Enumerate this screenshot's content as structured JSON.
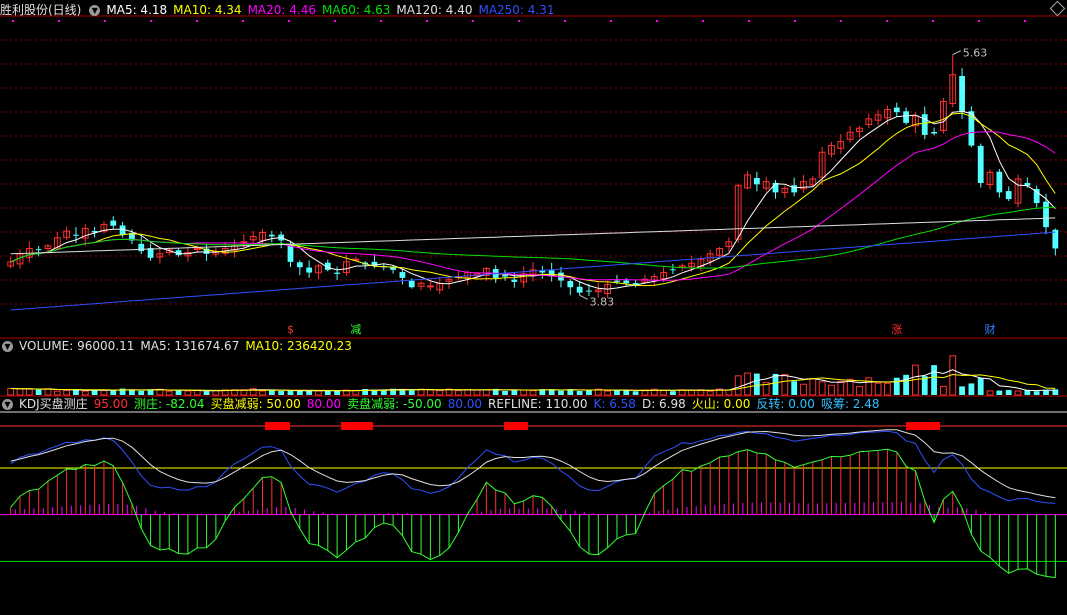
{
  "price_header": {
    "title": "胜利股份(日线)",
    "items": [
      {
        "label": "MA5:",
        "value": "4.18",
        "color": "#ffffff"
      },
      {
        "label": "MA10:",
        "value": "4.34",
        "color": "#ffff00"
      },
      {
        "label": "MA20:",
        "value": "4.46",
        "color": "#ff00ff"
      },
      {
        "label": "MA60:",
        "value": "4.63",
        "color": "#00e000"
      },
      {
        "label": "MA120:",
        "value": "4.40",
        "color": "#e0e0e0"
      },
      {
        "label": "MA250:",
        "value": "4.31",
        "color": "#3050ff"
      }
    ]
  },
  "volume_header": {
    "items": [
      {
        "label": "VOLUME:",
        "value": "96000.11",
        "color": "#e0e0e0"
      },
      {
        "label": "MA5:",
        "value": "131674.67",
        "color": "#e0e0e0"
      },
      {
        "label": "MA10:",
        "value": "236420.23",
        "color": "#ffff00"
      }
    ]
  },
  "kdj_header": {
    "title": "KDJ买盘测庄",
    "items": [
      {
        "label": "",
        "value": "95.00",
        "color": "#ff3030"
      },
      {
        "label": "测庄:",
        "value": "-82.04",
        "color": "#30ff30"
      },
      {
        "label": "买盘减弱:",
        "value": "50.00",
        "color": "#ffff00"
      },
      {
        "label": "",
        "value": "80.00",
        "color": "#ff00ff"
      },
      {
        "label": "卖盘减弱:",
        "value": "-50.00",
        "color": "#30ff30"
      },
      {
        "label": "",
        "value": "80.00",
        "color": "#3050ff"
      },
      {
        "label": "REFLINE:",
        "value": "110.00",
        "color": "#e0e0e0"
      },
      {
        "label": "K:",
        "value": "6.58",
        "color": "#3050ff"
      },
      {
        "label": "D:",
        "value": "6.98",
        "color": "#e0e0e0"
      },
      {
        "label": "火山:",
        "value": "0.00",
        "color": "#ffff00"
      },
      {
        "label": "反转:",
        "value": "0.00",
        "color": "#30c0ff"
      },
      {
        "label": "吸筹:",
        "value": "2.48",
        "color": "#30c0ff"
      }
    ]
  },
  "annotations": {
    "high_label": "5.63",
    "low_label": "3.83",
    "markers": [
      {
        "text": "$",
        "color": "#ff3030"
      },
      {
        "text": "减",
        "color": "#30ff30"
      },
      {
        "text": "涨",
        "color": "#ff3030"
      },
      {
        "text": "财",
        "color": "#3080ff"
      }
    ]
  },
  "colors": {
    "up": "#ff3030",
    "down": "#54ffff",
    "ma5": "#ffffff",
    "ma10": "#ffff00",
    "ma20": "#ff00ff",
    "ma60": "#00e000",
    "ma120": "#e0e0e0",
    "ma250": "#3050ff",
    "grid": "#8b0000",
    "border": "#b00000"
  },
  "chart_data": {
    "type": "candlestick",
    "price_range": [
      3.6,
      5.8
    ],
    "days": 113,
    "close": [
      4.08,
      4.14,
      4.18,
      4.17,
      4.2,
      4.26,
      4.31,
      4.28,
      4.33,
      4.3,
      4.36,
      4.35,
      4.28,
      4.24,
      4.16,
      4.11,
      4.14,
      4.17,
      4.13,
      4.15,
      4.18,
      4.14,
      4.16,
      4.18,
      4.2,
      4.23,
      4.27,
      4.3,
      4.27,
      4.24,
      4.08,
      4.04,
      4.0,
      4.05,
      4.02,
      3.99,
      4.08,
      4.1,
      4.06,
      4.05,
      4.04,
      4.02,
      3.96,
      3.89,
      3.92,
      3.9,
      3.92,
      3.95,
      3.97,
      4.0,
      3.99,
      4.03,
      3.96,
      3.97,
      3.93,
      3.99,
      4.02,
      4.0,
      3.97,
      3.94,
      3.89,
      3.85,
      3.86,
      3.87,
      3.91,
      3.93,
      3.92,
      3.9,
      3.95,
      3.97,
      4.0,
      4.02,
      4.05,
      4.07,
      4.1,
      4.14,
      4.18,
      4.23,
      4.65,
      4.73,
      4.66,
      4.68,
      4.6,
      4.63,
      4.6,
      4.68,
      4.7,
      4.9,
      4.95,
      4.98,
      5.05,
      5.08,
      5.15,
      5.18,
      5.22,
      5.2,
      5.12,
      5.17,
      5.03,
      5.04,
      5.28,
      5.48,
      5.2,
      4.95,
      4.67,
      4.75,
      4.6,
      4.55,
      4.7,
      4.65,
      4.52,
      4.34,
      4.18
    ],
    "volume_max": 450000,
    "kdj_range": [
      -100,
      110
    ],
    "ref_lines": {
      "refline": 110,
      "upper": 95,
      "mid": 50,
      "zero": 0,
      "lower": -50
    }
  }
}
